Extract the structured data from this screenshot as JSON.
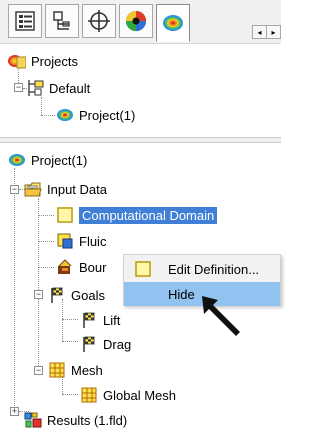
{
  "toolbar": {
    "buttons": [
      {
        "name": "feature-tree-tab",
        "icon": "feature-tree-icon"
      },
      {
        "name": "property-tree-tab",
        "icon": "property-manager-icon"
      },
      {
        "name": "configuration-tab",
        "icon": "crosshair-icon"
      },
      {
        "name": "display-tab",
        "icon": "appearance-sphere-icon"
      },
      {
        "name": "flow-simulation-tab",
        "icon": "flow-simulation-icon"
      }
    ],
    "scroll_left": "◂",
    "scroll_right": "▸"
  },
  "projects_panel": {
    "root_label": "Projects",
    "config_label": "Default",
    "project_label": "Project(1)",
    "splitter_grip": "....."
  },
  "analysis_tree": {
    "project": "Project(1)",
    "input_data": "Input Data",
    "computational_domain": "Computational Domain",
    "fluid": "Fluic",
    "boundary": "Bour",
    "goals": "Goals",
    "lift": "Lift",
    "drag": "Drag",
    "mesh": "Mesh",
    "global_mesh": "Global Mesh",
    "results": "Results (1.fld)"
  },
  "context_menu": {
    "items": [
      {
        "label": "Edit Definition...",
        "highlighted": false
      },
      {
        "label": "Hide",
        "highlighted": true
      }
    ]
  },
  "colors": {
    "selection": "#3f7fd6",
    "menu_highlight": "#92c2ef"
  }
}
